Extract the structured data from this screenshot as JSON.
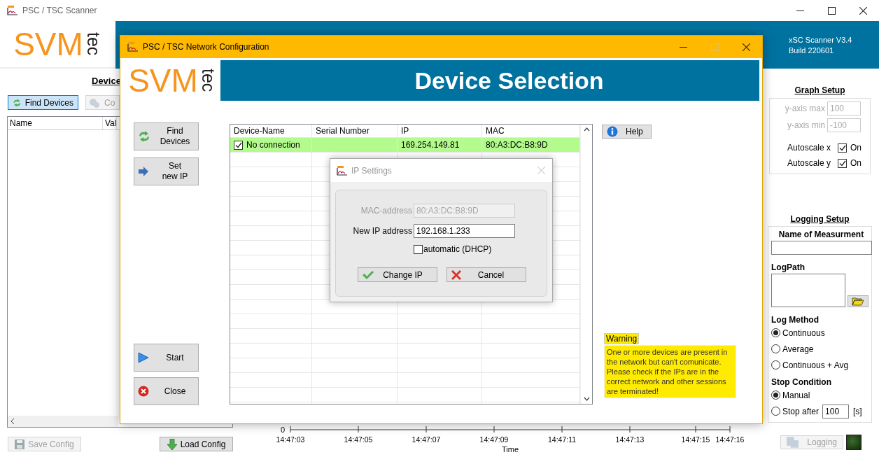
{
  "main_window": {
    "title": "PSC / TSC Scanner",
    "logo": {
      "brand": "SVM",
      "suffix": "tec"
    },
    "version": "xSC Scanner V3.4",
    "build": "Build 220601",
    "device_panel": {
      "heading": "Device",
      "buttons": [
        {
          "label": "Find Devices",
          "focused": true,
          "disabled": false
        },
        {
          "label": "Co",
          "focused": false,
          "disabled": true
        }
      ],
      "table": {
        "columns": [
          "Name",
          "Val"
        ]
      },
      "footer_buttons": [
        {
          "label": "Save Config",
          "disabled": true
        },
        {
          "label": "Load Config",
          "disabled": false
        }
      ]
    },
    "chart": {
      "y_tick": "0",
      "x_ticks": [
        "14:47:03",
        "14:47:05",
        "14:47:07",
        "14:47:09",
        "14:47:11",
        "14:47:13",
        "14:47:15",
        "14:47:16"
      ],
      "x_label": "Time"
    },
    "graph_setup": {
      "title": "Graph Setup",
      "fields": [
        {
          "label": "y-axis max",
          "value": "100",
          "disabled": true
        },
        {
          "label": "y-axis min",
          "value": "-100",
          "disabled": true
        }
      ],
      "checks": [
        {
          "label": "Autoscale x",
          "option": "On",
          "checked": true
        },
        {
          "label": "Autoscale y",
          "option": "On",
          "checked": true
        }
      ]
    },
    "logging_setup": {
      "title": "Logging Setup",
      "name_label": "Name of Measurment",
      "path_label": "LogPath",
      "log_method": {
        "label": "Log Method",
        "options": [
          {
            "label": "Continuous",
            "selected": true
          },
          {
            "label": "Average",
            "selected": false
          },
          {
            "label": "Continuous + Avg",
            "selected": false
          }
        ]
      },
      "stop_condition": {
        "label": "Stop Condition",
        "options": [
          {
            "label": "Manual",
            "selected": true
          },
          {
            "label": "Stop after",
            "selected": false,
            "value": "100",
            "unit": "[s]"
          }
        ]
      },
      "logging_button": {
        "label": "Logging",
        "disabled": true
      },
      "indicator": {
        "on": false
      }
    }
  },
  "network_window": {
    "title": "PSC / TSC Network Configuration",
    "logo": {
      "brand": "SVM",
      "suffix": "tec"
    },
    "banner": "Device Selection",
    "side_buttons": [
      {
        "label": "Find\nDevices"
      },
      {
        "label": "Set\nnew IP"
      }
    ],
    "bottom_buttons": [
      {
        "label": "Start"
      },
      {
        "label": "Close"
      }
    ],
    "table": {
      "columns": [
        "Device-Name",
        "Serial Number",
        "IP",
        "MAC"
      ],
      "rows": [
        {
          "device_name": "No connection",
          "ip": "169.254.149.81",
          "mac": "80:A3:DC:B8:9D",
          "checked": true,
          "selected": true
        }
      ]
    },
    "help_button": "Help",
    "warning": {
      "title": "Warning",
      "text": "One or more devices are present in the network but can't comunicate. Please check if the IPs are in the correct network and other sessions are terminated!"
    }
  },
  "ip_dialog": {
    "title": "IP Settings",
    "mac_label": "MAC-address",
    "mac_value": "80:A3:DC:B8:9D",
    "ip_label": "New IP address",
    "ip_value": "192.168.1.233",
    "dhcp": {
      "label": "automatic (DHCP)",
      "checked": false
    },
    "buttons": [
      {
        "label": "Change IP"
      },
      {
        "label": "Cancel"
      }
    ]
  }
}
